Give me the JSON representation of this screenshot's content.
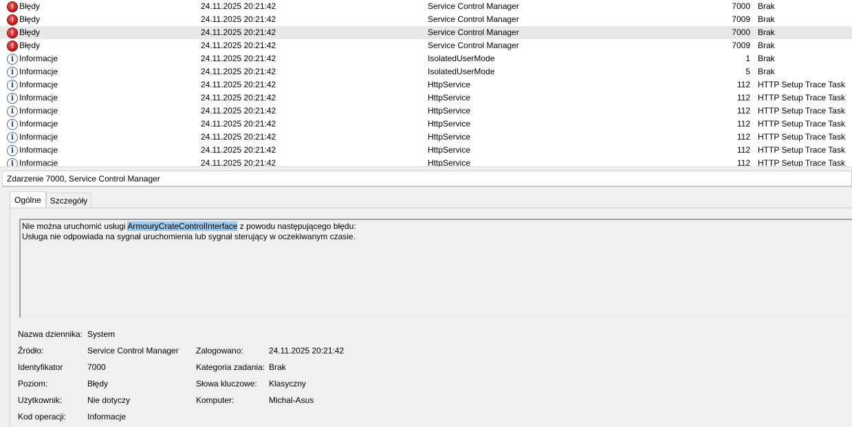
{
  "events": [
    {
      "level": "Błędy",
      "icon": "error-icon",
      "date": "24.11.2025 20:21:42",
      "source": "Service Control Manager",
      "id": "7000",
      "task": "Brak",
      "selected": false
    },
    {
      "level": "Błędy",
      "icon": "error-icon",
      "date": "24.11.2025 20:21:42",
      "source": "Service Control Manager",
      "id": "7009",
      "task": "Brak",
      "selected": false
    },
    {
      "level": "Błędy",
      "icon": "error-icon",
      "date": "24.11.2025 20:21:42",
      "source": "Service Control Manager",
      "id": "7000",
      "task": "Brak",
      "selected": true
    },
    {
      "level": "Błędy",
      "icon": "error-icon",
      "date": "24.11.2025 20:21:42",
      "source": "Service Control Manager",
      "id": "7009",
      "task": "Brak",
      "selected": false
    },
    {
      "level": "Informacje",
      "icon": "info-icon",
      "date": "24.11.2025 20:21:42",
      "source": "IsolatedUserMode",
      "id": "1",
      "task": "Brak",
      "selected": false
    },
    {
      "level": "Informacje",
      "icon": "info-icon",
      "date": "24.11.2025 20:21:42",
      "source": "IsolatedUserMode",
      "id": "5",
      "task": "Brak",
      "selected": false
    },
    {
      "level": "Informacje",
      "icon": "info-icon",
      "date": "24.11.2025 20:21:42",
      "source": "HttpService",
      "id": "112",
      "task": "HTTP Setup Trace Task",
      "selected": false
    },
    {
      "level": "Informacje",
      "icon": "info-icon",
      "date": "24.11.2025 20:21:42",
      "source": "HttpService",
      "id": "112",
      "task": "HTTP Setup Trace Task",
      "selected": false
    },
    {
      "level": "Informacje",
      "icon": "info-icon",
      "date": "24.11.2025 20:21:42",
      "source": "HttpService",
      "id": "112",
      "task": "HTTP Setup Trace Task",
      "selected": false
    },
    {
      "level": "Informacje",
      "icon": "info-icon",
      "date": "24.11.2025 20:21:42",
      "source": "HttpService",
      "id": "112",
      "task": "HTTP Setup Trace Task",
      "selected": false
    },
    {
      "level": "Informacje",
      "icon": "info-icon",
      "date": "24.11.2025 20:21:42",
      "source": "HttpService",
      "id": "112",
      "task": "HTTP Setup Trace Task",
      "selected": false
    },
    {
      "level": "Informacje",
      "icon": "info-icon",
      "date": "24.11.2025 20:21:42",
      "source": "HttpService",
      "id": "112",
      "task": "HTTP Setup Trace Task",
      "selected": false
    },
    {
      "level": "Informacje",
      "icon": "info-icon",
      "date": "24.11.2025 20:21:42",
      "source": "HttpService",
      "id": "112",
      "task": "HTTP Setup Trace Task",
      "selected": false
    }
  ],
  "detail": {
    "title": "Zdarzenie 7000, Service Control Manager",
    "tabs": [
      "Ogólne",
      "Szczegóły"
    ],
    "active_tab": "Ogólne",
    "message": {
      "line1_before": "Nie można uruchomić usługi ",
      "line1_highlight": "ArmouryCrateControlInterface",
      "line1_after": " z powodu następującego błędu:",
      "line2": "Usługa nie odpowiada na sygnał uruchomienia lub sygnał sterujący w oczekiwanym czasie."
    },
    "properties": {
      "log_name_label": "Nazwa dziennika:",
      "log_name_value": "System",
      "source_label": "Źródło:",
      "source_value": "Service Control Manager",
      "logged_label": "Zalogowano:",
      "logged_value": "24.11.2025 20:21:42",
      "event_id_label": "Identyfikator",
      "event_id_value": "7000",
      "task_category_label": "Kategoria zadania:",
      "task_category_value": "Brak",
      "level_label": "Poziom:",
      "level_value": "Błędy",
      "keywords_label": "Słowa kluczowe:",
      "keywords_value": "Klasyczny",
      "user_label": "Użytkownik:",
      "user_value": "Nie dotyczy",
      "computer_label": "Komputer:",
      "computer_value": "Michal-Asus",
      "opcode_label": "Kod operacji:",
      "opcode_value": "Informacje"
    }
  },
  "colors": {
    "highlight": "#99c9ef",
    "selected_row": "#e8e8e8",
    "error_red": "#c81414",
    "info_blue": "#2c4b7a"
  }
}
